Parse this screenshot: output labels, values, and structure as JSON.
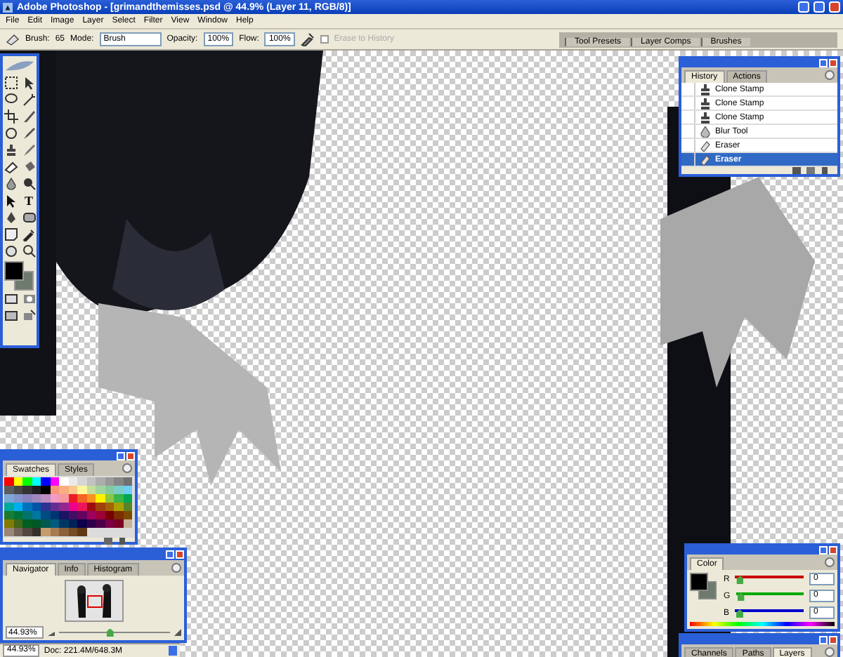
{
  "window": {
    "title": "Adobe Photoshop - [grimandthemisses.psd @ 44.9% (Layer 11, RGB/8)]"
  },
  "menu": [
    "File",
    "Edit",
    "Image",
    "Layer",
    "Select",
    "Filter",
    "View",
    "Window",
    "Help"
  ],
  "options_bar": {
    "brush_label": "Brush:",
    "brush_size": "65",
    "mode_label": "Mode:",
    "mode": "Brush",
    "opacity_label": "Opacity:",
    "opacity": "100%",
    "flow_label": "Flow:",
    "flow": "100%",
    "erase_to_history": {
      "label": "Erase to History",
      "checked": false,
      "disabled": true
    }
  },
  "palette_well": {
    "tabs": [
      "Tool Presets",
      "Layer Comps",
      "Brushes"
    ]
  },
  "toolbox": {
    "type_tool": "T"
  },
  "history": {
    "tabs": [
      {
        "label": "History",
        "selected": true
      },
      {
        "label": "Actions",
        "selected": false
      }
    ],
    "items": [
      {
        "label": "Clone Stamp",
        "kind": "stamp",
        "selected": false
      },
      {
        "label": "Clone Stamp",
        "kind": "stamp",
        "selected": false
      },
      {
        "label": "Clone Stamp",
        "kind": "stamp",
        "selected": false
      },
      {
        "label": "Blur Tool",
        "kind": "blur",
        "selected": false
      },
      {
        "label": "Eraser",
        "kind": "eraser",
        "selected": false
      },
      {
        "label": "Eraser",
        "kind": "eraser",
        "selected": true
      }
    ]
  },
  "swatches": {
    "tabs": [
      {
        "label": "Swatches",
        "selected": true
      },
      {
        "label": "Styles",
        "selected": false
      }
    ],
    "items": [
      {
        "color": "#ff0000"
      },
      {
        "color": "#ffff00"
      },
      {
        "color": "#00ff00"
      },
      {
        "color": "#00ffff"
      },
      {
        "color": "#0000ff"
      },
      {
        "color": "#ff00ff"
      },
      {
        "color": "#ffffff"
      },
      {
        "color": "#ebebeb"
      },
      {
        "color": "#d6d6d6"
      },
      {
        "color": "#c2c2c2"
      },
      {
        "color": "#adadad"
      },
      {
        "color": "#999999"
      },
      {
        "color": "#858585"
      },
      {
        "color": "#707070"
      },
      {
        "color": "#5c5c5c"
      },
      {
        "color": "#474747"
      },
      {
        "color": "#333333"
      },
      {
        "color": "#1f1f1f"
      },
      {
        "color": "#000000"
      },
      {
        "color": "#f7977a"
      },
      {
        "color": "#f9ad81"
      },
      {
        "color": "#fdc68a"
      },
      {
        "color": "#fff79a"
      },
      {
        "color": "#c4df9b"
      },
      {
        "color": "#a2d39c"
      },
      {
        "color": "#82ca9d"
      },
      {
        "color": "#7bcdc8"
      },
      {
        "color": "#6ecff6"
      },
      {
        "color": "#7ea7d8"
      },
      {
        "color": "#8493ca"
      },
      {
        "color": "#8882be"
      },
      {
        "color": "#a187be"
      },
      {
        "color": "#bc8dbf"
      },
      {
        "color": "#f49ac2"
      },
      {
        "color": "#f6989d"
      },
      {
        "color": "#ed1c24"
      },
      {
        "color": "#f26522"
      },
      {
        "color": "#f7941d"
      },
      {
        "color": "#fff200"
      },
      {
        "color": "#8dc63f"
      },
      {
        "color": "#39b54a"
      },
      {
        "color": "#00a651"
      },
      {
        "color": "#00a99d"
      },
      {
        "color": "#00aeef"
      },
      {
        "color": "#0072bc"
      },
      {
        "color": "#0054a6"
      },
      {
        "color": "#2e3192"
      },
      {
        "color": "#662d91"
      },
      {
        "color": "#92278f"
      },
      {
        "color": "#ec008c"
      },
      {
        "color": "#ed145b"
      },
      {
        "color": "#9e0b0f"
      },
      {
        "color": "#a0410d"
      },
      {
        "color": "#a36209"
      },
      {
        "color": "#aba000"
      },
      {
        "color": "#598527"
      },
      {
        "color": "#197b30"
      },
      {
        "color": "#007236"
      },
      {
        "color": "#00746b"
      },
      {
        "color": "#0076a3"
      },
      {
        "color": "#004b80"
      },
      {
        "color": "#003471"
      },
      {
        "color": "#1b1464"
      },
      {
        "color": "#440e62"
      },
      {
        "color": "#630460"
      },
      {
        "color": "#9e005d"
      },
      {
        "color": "#9e0039"
      },
      {
        "color": "#790000"
      },
      {
        "color": "#7b2e00"
      },
      {
        "color": "#7d4900"
      },
      {
        "color": "#827b00"
      },
      {
        "color": "#406618"
      },
      {
        "color": "#005e20"
      },
      {
        "color": "#005826"
      },
      {
        "color": "#005952"
      },
      {
        "color": "#005b7f"
      },
      {
        "color": "#003663"
      },
      {
        "color": "#002157"
      },
      {
        "color": "#0d004c"
      },
      {
        "color": "#32004b"
      },
      {
        "color": "#4b0049"
      },
      {
        "color": "#7b0046"
      },
      {
        "color": "#7a0026"
      },
      {
        "color": "#c7b299"
      },
      {
        "color": "#998675"
      },
      {
        "color": "#736357"
      },
      {
        "color": "#534741"
      },
      {
        "color": "#37302a"
      },
      {
        "color": "#c69c6d"
      },
      {
        "color": "#a67c52"
      },
      {
        "color": "#8c6239"
      },
      {
        "color": "#754c24"
      },
      {
        "color": "#603913"
      }
    ]
  },
  "navigator": {
    "tabs": [
      {
        "label": "Navigator",
        "selected": true
      },
      {
        "label": "Info",
        "selected": false
      },
      {
        "label": "Histogram",
        "selected": false
      }
    ],
    "zoom": "44.93%",
    "zoom_slider": {
      "level": 0.45
    }
  },
  "color": {
    "tabs": [
      {
        "label": "Color",
        "selected": true
      }
    ],
    "foreground": {
      "color": "#000000"
    },
    "background": {
      "color": "#6e7a6e"
    },
    "channels": [
      {
        "name": "R",
        "level": 0,
        "value": "0",
        "color": "#cc0000"
      },
      {
        "name": "G",
        "level": 0,
        "value": "0",
        "color": "#00aa00"
      },
      {
        "name": "B",
        "level": 0,
        "value": "0",
        "color": "#0000cc"
      }
    ]
  },
  "layers": {
    "tabs": [
      {
        "label": "Channels",
        "selected": false
      },
      {
        "label": "Paths",
        "selected": false
      },
      {
        "label": "Layers",
        "selected": true
      }
    ]
  },
  "status_bar": {
    "zoom": "44.93%",
    "doc": "Doc: 221.4M/648.3M"
  }
}
